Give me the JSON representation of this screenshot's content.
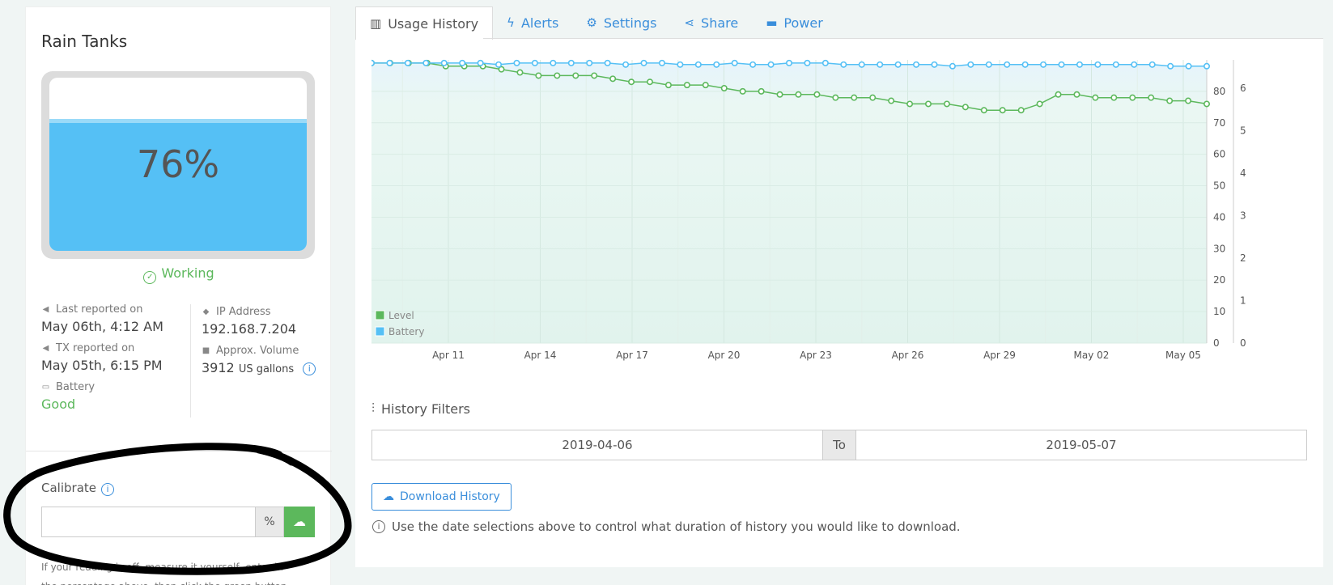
{
  "device": {
    "title": "Rain Tanks",
    "level_percent": 76,
    "level_label": "76%",
    "status": "Working",
    "last_reported_label": "Last reported on",
    "last_reported_value": "May 06th, 4:12 AM",
    "tx_reported_label": "TX reported on",
    "tx_reported_value": "May 05th, 6:15 PM",
    "battery_label": "Battery",
    "battery_value": "Good",
    "ip_label": "IP Address",
    "ip_value": "192.168.7.204",
    "volume_label": "Approx. Volume",
    "volume_value": "3912",
    "volume_unit": "US gallons"
  },
  "calibrate": {
    "label": "Calibrate",
    "input_value": "",
    "unit": "%",
    "help": "If your reading is off, measure it yourself, enter in the percentage above, then click the green button."
  },
  "tabs": [
    {
      "label": "Usage History",
      "icon": "bar-chart-icon",
      "active": true
    },
    {
      "label": "Alerts",
      "icon": "bolt-icon",
      "active": false
    },
    {
      "label": "Settings",
      "icon": "gear-icon",
      "active": false
    },
    {
      "label": "Share",
      "icon": "share-icon",
      "active": false
    },
    {
      "label": "Power",
      "icon": "battery-icon",
      "active": false
    }
  ],
  "filters": {
    "title": "History Filters",
    "from": "2019-04-06",
    "to_label": "To",
    "to": "2019-05-07",
    "download_label": "Download History",
    "help": "Use the date selections above to control what duration of history you would like to download."
  },
  "colors": {
    "level": "#5cb85c",
    "battery": "#55c0f5",
    "accent": "#3a8edb"
  },
  "chart_data": {
    "type": "line",
    "xlabel": "",
    "x_ticks": [
      "Apr 11",
      "Apr 14",
      "Apr 17",
      "Apr 20",
      "Apr 23",
      "Apr 26",
      "Apr 29",
      "May 02",
      "May 05"
    ],
    "y_left_ticks": [
      0,
      10,
      20,
      30,
      40,
      50,
      60,
      70,
      80
    ],
    "y_left_lim": [
      0,
      90
    ],
    "y_right_ticks": [
      0,
      1,
      2,
      3,
      4,
      5,
      6
    ],
    "y_right_lim": [
      0,
      6.67
    ],
    "legend_position": "bottom-left",
    "grid": true,
    "series": [
      {
        "name": "Level",
        "axis": "left",
        "values": [
          89,
          89,
          89,
          89,
          88,
          88,
          88,
          87,
          86,
          85,
          85,
          85,
          85,
          84,
          83,
          83,
          82,
          82,
          82,
          81,
          80,
          80,
          79,
          79,
          79,
          78,
          78,
          78,
          77,
          76,
          76,
          76,
          75,
          74,
          74,
          74,
          76,
          79,
          79,
          78,
          78,
          78,
          78,
          77,
          77,
          76
        ]
      },
      {
        "name": "Battery",
        "axis": "left",
        "values": [
          89,
          89,
          89,
          89,
          89,
          89,
          89,
          88.5,
          89,
          89,
          89,
          89,
          89,
          89,
          88.5,
          89,
          89,
          88.5,
          88.5,
          88.5,
          89,
          88.5,
          88.5,
          89,
          89,
          89,
          88.5,
          88.5,
          88.5,
          88.5,
          88.5,
          88.5,
          88,
          88.5,
          88.5,
          88.5,
          88.5,
          88.5,
          88.5,
          88.5,
          88.5,
          88.5,
          88.5,
          88.5,
          88,
          88,
          88
        ]
      }
    ]
  }
}
